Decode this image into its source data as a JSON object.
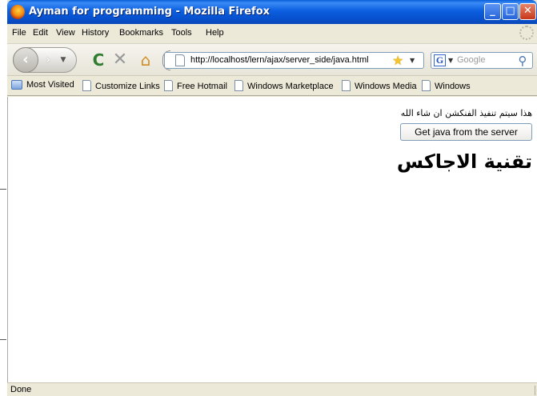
{
  "window": {
    "title": "Ayman for programming - Mozilla Firefox",
    "controls": {
      "minimize": "_",
      "maximize": "□",
      "close": "✕"
    }
  },
  "menu": {
    "items": [
      "File",
      "Edit",
      "View",
      "History",
      "Bookmarks",
      "Tools",
      "Help"
    ]
  },
  "nav": {
    "back_glyph": "‹",
    "forward_glyph": "›",
    "reload_glyph": "C",
    "stop_glyph": "✕",
    "home_glyph": "⌂",
    "url": "http://localhost/lern/ajax/server_side/java.html",
    "star_glyph": "★",
    "search_engine_glyph": "G",
    "search_placeholder": "Google",
    "search_glyph": "⚲"
  },
  "bookmarks": {
    "items": [
      {
        "label": "Most Visited",
        "icon": "folder-icon"
      },
      {
        "label": "Customize Links",
        "icon": "page-icon"
      },
      {
        "label": "Free Hotmail",
        "icon": "page-icon"
      },
      {
        "label": "Windows Marketplace",
        "icon": "page-icon"
      },
      {
        "label": "Windows Media",
        "icon": "page-icon"
      },
      {
        "label": "Windows",
        "icon": "page-icon"
      }
    ]
  },
  "content": {
    "note": "هذا سيتم تنفيذ الفنكشن ان شاء الله",
    "button_label": "Get java from the server",
    "heading": "تقنية الاجاكس"
  },
  "status": {
    "text": "Done"
  }
}
